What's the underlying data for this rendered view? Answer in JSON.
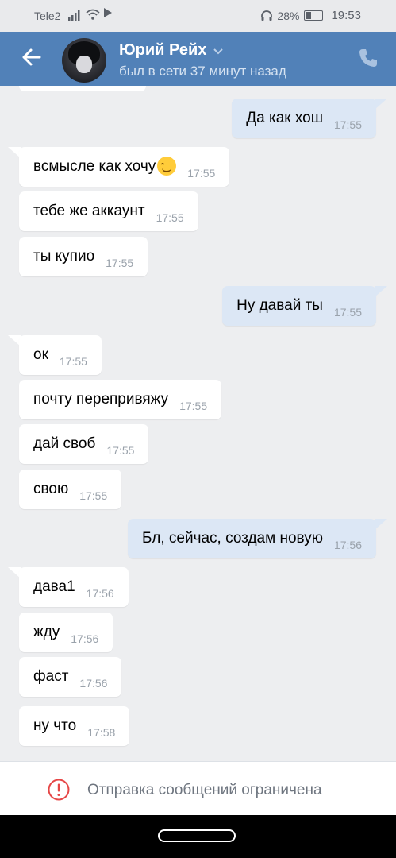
{
  "status_bar": {
    "carrier": "Tele2",
    "battery": "28%",
    "time": "19:53"
  },
  "header": {
    "name": "Юрий Рейх",
    "last_seen": "был в сети 37 минут назад"
  },
  "messages": [
    {
      "dir": "out",
      "text": "Да как хош",
      "time": "17:55"
    },
    {
      "dir": "in",
      "text": "всмысле как хочу",
      "emoji": "smiling-face",
      "time": "17:55"
    },
    {
      "dir": "in",
      "text": "тебе же аккаунт",
      "time": "17:55"
    },
    {
      "dir": "in",
      "text": "ты купио",
      "time": "17:55"
    },
    {
      "dir": "out",
      "text": "Ну давай ты",
      "time": "17:55"
    },
    {
      "dir": "in",
      "text": "ок",
      "time": "17:55"
    },
    {
      "dir": "in",
      "text": "почту перепривяжу",
      "time": "17:55"
    },
    {
      "dir": "in",
      "text": "дай своб",
      "time": "17:55"
    },
    {
      "dir": "in",
      "text": "свою",
      "time": "17:55"
    },
    {
      "dir": "out",
      "text": "Бл, сейчас, создам новую",
      "time": "17:56"
    },
    {
      "dir": "in",
      "text": "дава1",
      "time": "17:56"
    },
    {
      "dir": "in",
      "text": "жду",
      "time": "17:56"
    },
    {
      "dir": "in",
      "text": "фаст",
      "time": "17:56"
    },
    {
      "dir": "in",
      "text": "ну что",
      "time": "17:58"
    }
  ],
  "footer": {
    "restriction_text": "Отправка сообщений ограничена"
  },
  "colors": {
    "header": "#5181b8",
    "incoming_bubble": "#ffffff",
    "outgoing_bubble": "#dce7f5",
    "background": "#edeef0"
  }
}
